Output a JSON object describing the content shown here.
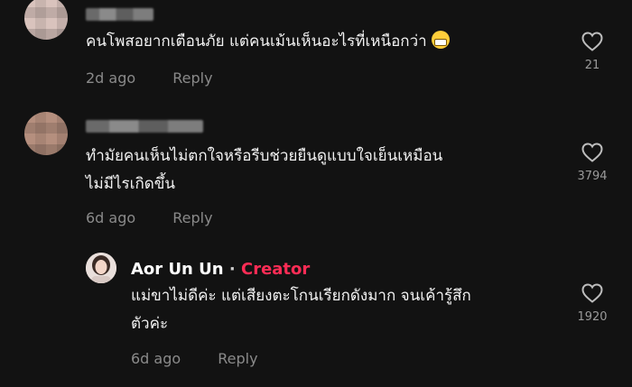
{
  "comments": [
    {
      "text": "คนโพสอยากเตือนภัย แต่คนเม้นเห็นอะไรที่เหนือกว่า",
      "emoji": "grinning-face",
      "time": "2d ago",
      "reply": "Reply",
      "likes": "21"
    },
    {
      "lines": [
        "ทำมัยคนเห็นไม่ตกใจหรือรีบช่วยยืนดูแบบใจเย็นเหมือน",
        "ไม่มีไรเกิดขึ้น"
      ],
      "time": "6d ago",
      "reply": "Reply",
      "likes": "3794"
    }
  ],
  "creator_reply": {
    "name": "Aor Un Un",
    "separator": "·",
    "tag": "Creator",
    "lines": [
      "แม่ขาไม่ดีค่ะ แต่เสียงตะโกนเรียกดังมาก จนเค้ารู้สึก",
      "ตัวค่ะ"
    ],
    "time": "6d ago",
    "reply": "Reply",
    "likes": "1920"
  },
  "colors": {
    "background": "#121212",
    "creator_tag": "#fe2c55",
    "meta_text": "#8a8a8a"
  }
}
